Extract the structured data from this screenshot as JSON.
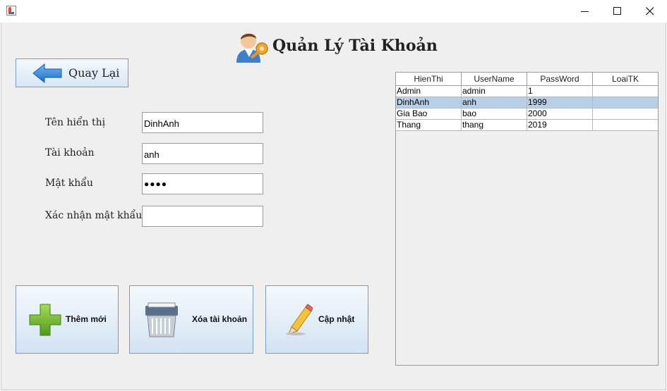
{
  "window": {
    "title": ""
  },
  "header": {
    "title": "Quản Lý Tài Khoản"
  },
  "back_button": {
    "label": "Quay Lại"
  },
  "form": {
    "display_name": {
      "label": "Tên hiển thị",
      "value": "DinhAnh"
    },
    "username": {
      "label": "Tài khoản",
      "value": "anh"
    },
    "password": {
      "label": "Mật khẩu",
      "value": "●●●●"
    },
    "confirm_password": {
      "label": "Xác nhận mật khẩu",
      "value": ""
    }
  },
  "actions": {
    "add_label": "Thêm mới",
    "delete_label": "Xóa tài khoản",
    "update_label": "Cập nhật"
  },
  "table": {
    "columns": [
      "HienThi",
      "UserName",
      "PassWord",
      "LoaiTK"
    ],
    "rows": [
      [
        "Admin",
        "admin",
        "1",
        ""
      ],
      [
        "DinhAnh",
        "anh",
        "1999",
        ""
      ],
      [
        "Gia Bao",
        "bao",
        "2000",
        ""
      ],
      [
        "Thang",
        "thang",
        "2019",
        ""
      ]
    ],
    "selected_row": 1
  },
  "colors": {
    "accent": "#b8cfe5",
    "button_border": "#7a9cc4"
  },
  "icons": {
    "app": "java-cup-icon",
    "header": "user-key-icon",
    "back": "arrow-left-icon",
    "add": "plus-icon",
    "delete": "shredder-icon",
    "update": "pencil-icon"
  }
}
